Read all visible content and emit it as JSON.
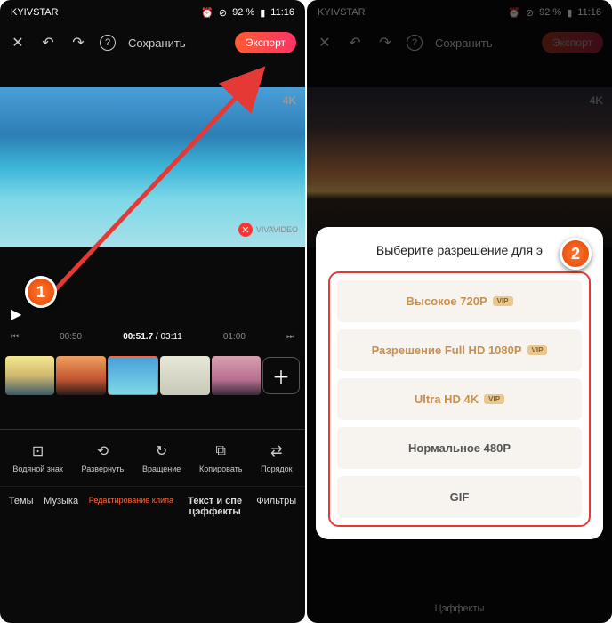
{
  "status": {
    "carrier": "KYIVSTAR",
    "battery": "92 %",
    "time": "11:16"
  },
  "appbar": {
    "save": "Сохранить",
    "export": "Экспорт"
  },
  "preview": {
    "badge4k": "4K",
    "watermark": "VIVAVIDEO"
  },
  "timeline": {
    "start": "00:50",
    "current": "00:51.7",
    "total": "03:11",
    "end": "01:00"
  },
  "tools": [
    {
      "name": "watermark",
      "label": "Водяной знак"
    },
    {
      "name": "expand",
      "label": "Развернуть"
    },
    {
      "name": "rotate",
      "label": "Вращение"
    },
    {
      "name": "copy",
      "label": "Копировать"
    },
    {
      "name": "order",
      "label": "Порядок"
    }
  ],
  "tabs": [
    {
      "name": "themes",
      "label": "Темы"
    },
    {
      "name": "music",
      "label": "Музыка"
    },
    {
      "name": "editing",
      "label": "Редактирование клипа",
      "active": true
    },
    {
      "name": "text",
      "label": "Текст и спе цэффекты",
      "bold": true
    },
    {
      "name": "filters",
      "label": "Фильтры"
    }
  ],
  "tabs_dim": {
    "effects": "Цэффекты"
  },
  "modal": {
    "title": "Выберите разрешение для э",
    "options": [
      {
        "label": "Высокое 720P",
        "vip": true
      },
      {
        "label": "Разрешение Full HD 1080P",
        "vip": true
      },
      {
        "label": "Ultra HD 4K",
        "vip": true
      },
      {
        "label": "Нормальное 480P",
        "vip": false
      },
      {
        "label": "GIF",
        "vip": false
      }
    ],
    "vip_badge": "VIP"
  },
  "callouts": {
    "step1": "1",
    "step2": "2"
  }
}
